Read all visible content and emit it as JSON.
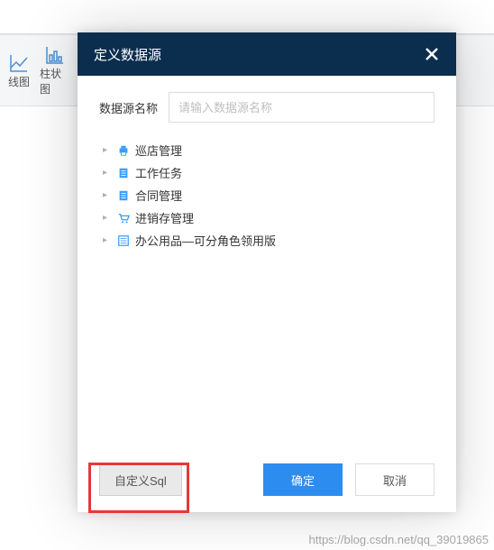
{
  "ribbon": {
    "items": [
      {
        "label": "线图"
      },
      {
        "label": "柱状图"
      }
    ]
  },
  "modal": {
    "title": "定义数据源",
    "form": {
      "nameLabel": "数据源名称",
      "namePlaceholder": "请输入数据源名称",
      "nameValue": ""
    },
    "tree": [
      {
        "icon": "printer",
        "label": "巡店管理"
      },
      {
        "icon": "doc",
        "label": "工作任务"
      },
      {
        "icon": "doc",
        "label": "合同管理"
      },
      {
        "icon": "cart",
        "label": "进销存管理"
      },
      {
        "icon": "list",
        "label": "办公用品—可分角色领用版"
      }
    ],
    "footer": {
      "customSql": "自定义Sql",
      "confirm": "确定",
      "cancel": "取消"
    }
  },
  "watermark": "https://blog.csdn.net/qq_39019865"
}
